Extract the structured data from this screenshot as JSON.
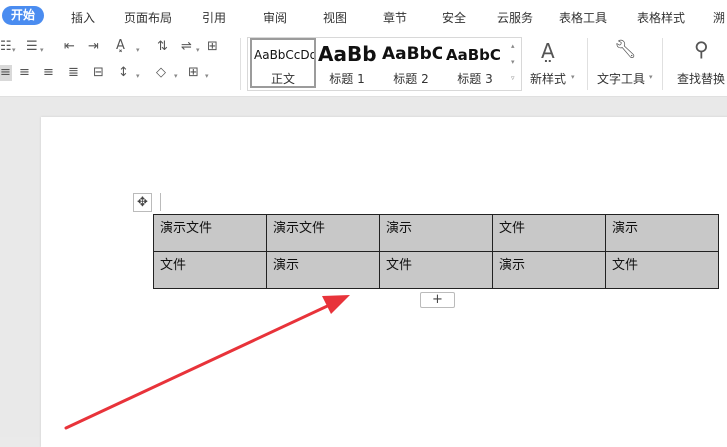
{
  "menu": {
    "tabs": [
      {
        "label": "开始",
        "active": true
      },
      {
        "label": "插入"
      },
      {
        "label": "页面布局"
      },
      {
        "label": "引用"
      },
      {
        "label": "审阅"
      },
      {
        "label": "视图"
      },
      {
        "label": "章节"
      },
      {
        "label": "安全"
      },
      {
        "label": "云服务"
      },
      {
        "label": "表格工具"
      },
      {
        "label": "表格样式"
      },
      {
        "label": "溯"
      }
    ]
  },
  "ribbon": {
    "styles": [
      {
        "sample": "AaBbCcDd",
        "label": "正文"
      },
      {
        "sample": "AaBb",
        "label": "标题 1"
      },
      {
        "sample": "AaBbC",
        "label": "标题 2"
      },
      {
        "sample": "AaBbC",
        "label": "标题 3"
      }
    ],
    "new_style_label": "新样式",
    "text_tools_label": "文字工具",
    "find_replace_label": "查找替换"
  },
  "table": {
    "rows": [
      [
        "演示文件",
        "演示文件",
        "演示",
        "文件",
        "演示"
      ],
      [
        "文件",
        "演示",
        "文件",
        "演示",
        "文件"
      ]
    ]
  },
  "add_row_label": "+",
  "colors": {
    "accent": "#4a8cf0",
    "cell_bg": "#c8c8c8",
    "arrow": "#e8333a"
  }
}
